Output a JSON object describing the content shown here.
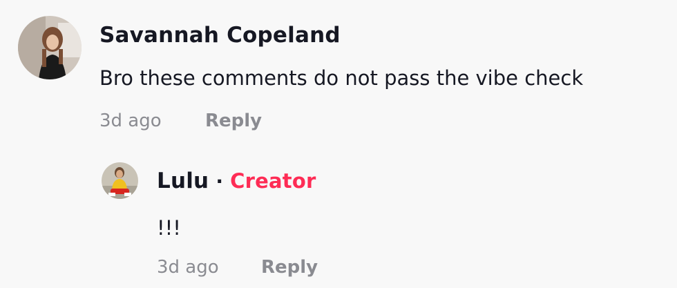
{
  "comments": [
    {
      "avatar_icon": "user-photo-avatar",
      "username": "Savannah Copeland",
      "text": "Bro these comments do not pass the vibe check",
      "time": "3d ago",
      "reply_label": "Reply"
    }
  ],
  "replies": [
    {
      "avatar_icon": "user-photo-avatar",
      "username": "Lulu",
      "separator": "·",
      "badge": "Creator",
      "text": "!!!",
      "time": "3d ago",
      "reply_label": "Reply"
    }
  ],
  "colors": {
    "background": "#f8f8f8",
    "text": "#161823",
    "muted": "#8a8b91",
    "creator_badge": "#fe2c55"
  }
}
